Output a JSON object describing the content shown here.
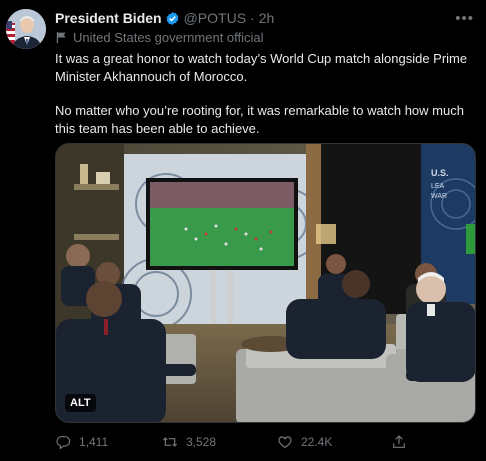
{
  "tweet": {
    "author_name": "President Biden",
    "handle": "@POTUS",
    "separator": "·",
    "time": "2h",
    "affiliation": "United States government official",
    "more_icon": "more-horizontal-icon",
    "paragraphs": [
      "It was a great honor to watch today’s World Cup match alongside Prime Minister Akhannouch of Morocco.",
      "No matter who you’re rooting for, it was remarkable to watch how much this team has been able to achieve."
    ],
    "media": {
      "alt_label": "ALT",
      "wall_sign_text": "U.S. LEA WAR"
    },
    "actions": {
      "replies": "1,411",
      "retweets": "3,528",
      "likes": "22.4K"
    }
  },
  "colors": {
    "background": "#000000",
    "text_primary": "#e7e9ea",
    "text_secondary": "#71767b",
    "verified": "#1d9bf0"
  }
}
